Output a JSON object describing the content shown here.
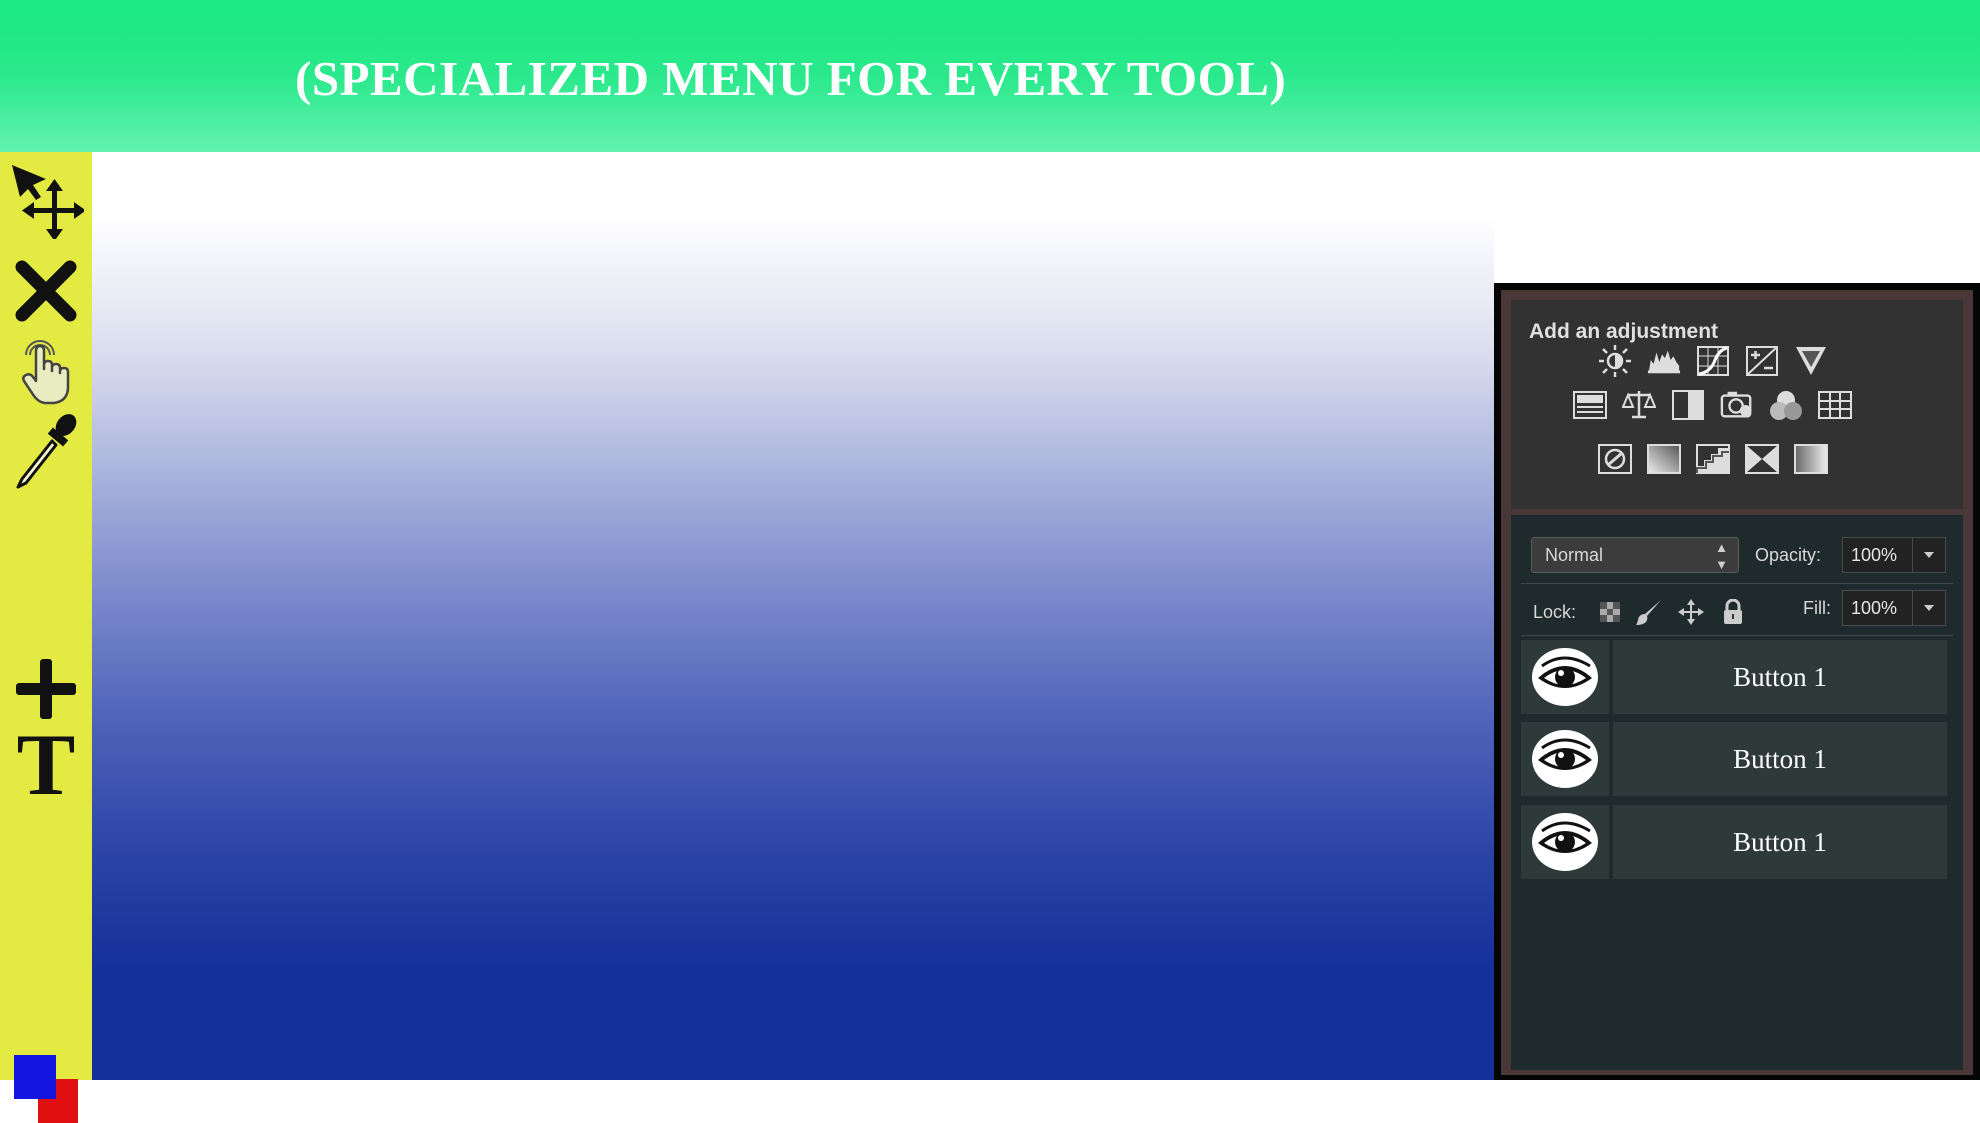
{
  "header": {
    "title": "(SPECIALIZED MENU FOR EVERY TOOL)"
  },
  "toolbar": {
    "tools": [
      {
        "name": "move-tool",
        "icon": "move-arrow-icon"
      },
      {
        "name": "delete-tool",
        "icon": "close-icon"
      },
      {
        "name": "hand-tool",
        "icon": "hand-pointer-icon"
      },
      {
        "name": "eyedropper-tool",
        "icon": "eyedropper-icon"
      },
      {
        "name": "add-tool",
        "icon": "plus-icon"
      },
      {
        "name": "text-tool",
        "icon": "text-icon",
        "label": "T"
      }
    ],
    "colors": {
      "foreground": "#1216e0",
      "background": "#e01010"
    }
  },
  "panel": {
    "adjustments_title": "Add an adjustment",
    "adjustment_icons": [
      [
        "brightness-icon",
        "levels-icon",
        "curves-icon",
        "exposure-icon",
        "vibrance-icon"
      ],
      [
        "hue-saturation-icon",
        "color-balance-icon",
        "black-white-icon",
        "photo-filter-icon",
        "channel-mixer-icon",
        "color-lookup-icon"
      ],
      [
        "invert-icon",
        "posterize-icon",
        "threshold-icon",
        "selective-color-icon",
        "gradient-map-icon"
      ]
    ],
    "layers": {
      "blend_mode": "Normal",
      "opacity_label": "Opacity:",
      "opacity_value": "100%",
      "lock_label": "Lock:",
      "fill_label": "Fill:",
      "fill_value": "100%",
      "rows": [
        {
          "label": "Button 1"
        },
        {
          "label": "Button 1"
        },
        {
          "label": "Button 1"
        }
      ]
    }
  }
}
